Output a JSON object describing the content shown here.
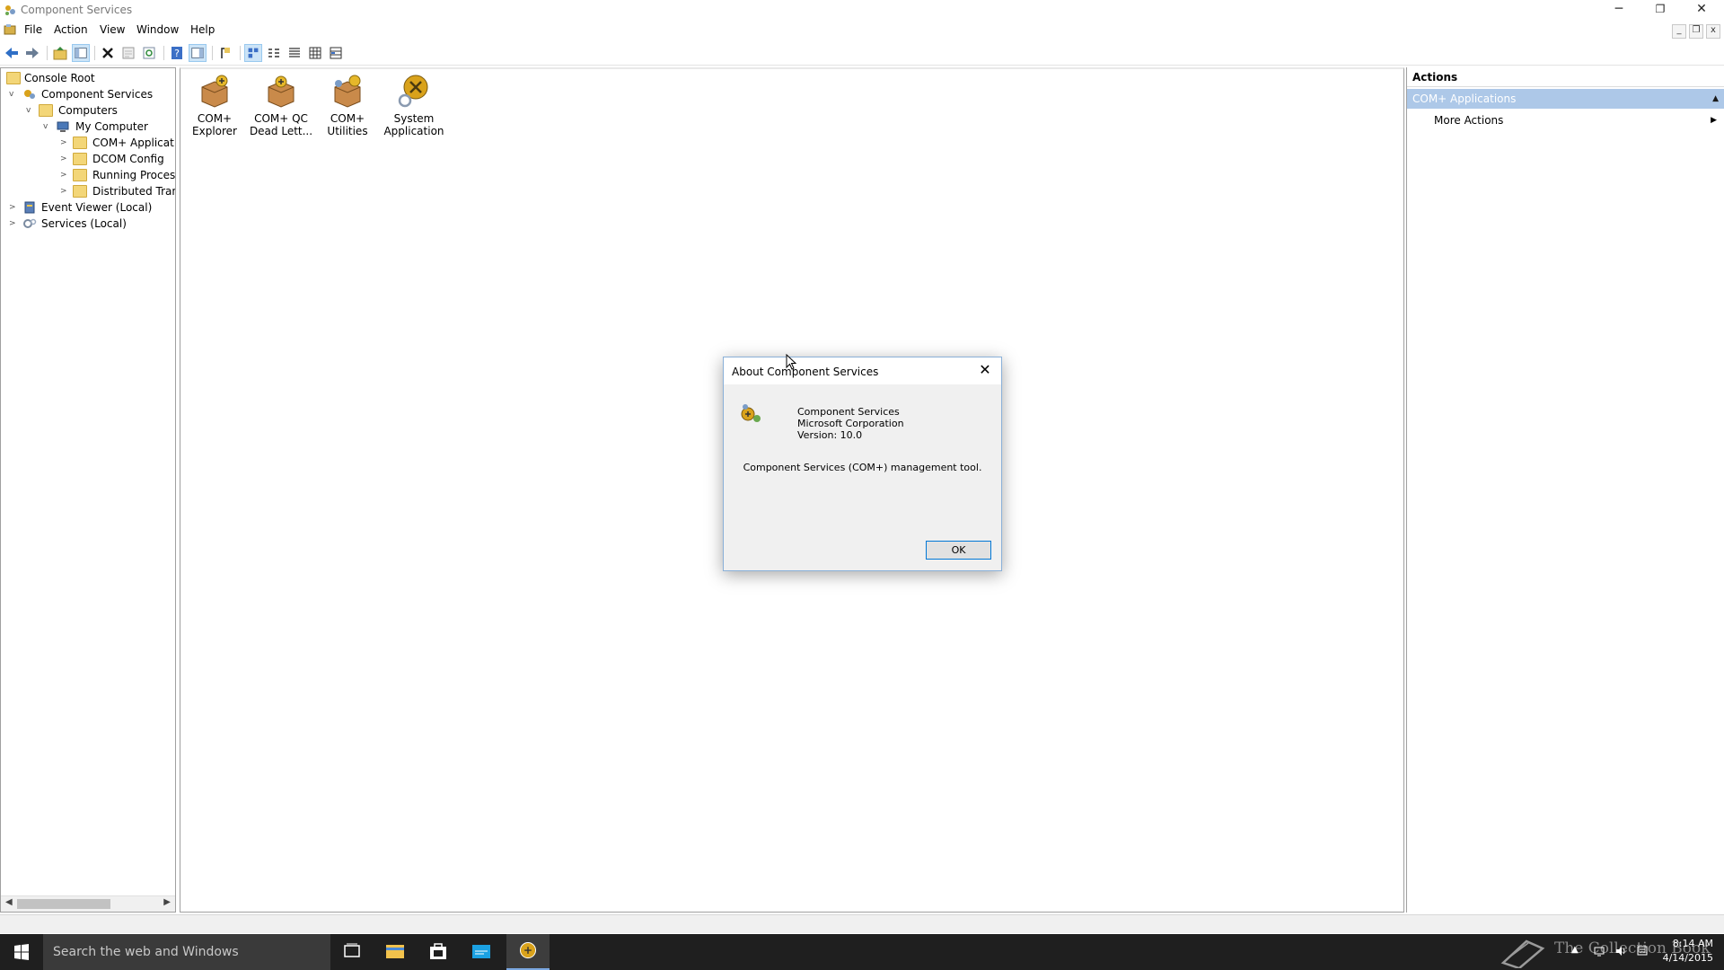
{
  "window": {
    "title": "Component Services",
    "controls": {
      "minimize": "─",
      "restore": "❐",
      "close": "✕"
    }
  },
  "menu": {
    "items": [
      {
        "label": "File"
      },
      {
        "label": "Action"
      },
      {
        "label": "View"
      },
      {
        "label": "Window"
      },
      {
        "label": "Help"
      }
    ],
    "mdi": {
      "minimize": "_",
      "restore": "❐",
      "close": "x"
    }
  },
  "toolbar": {
    "icons": [
      "back-icon",
      "forward-icon",
      "up-folder-icon",
      "show-hide-tree-icon",
      "delete-icon",
      "properties-icon",
      "refresh-icon",
      "help-icon",
      "show-hide-action-pane-icon",
      "export-list-icon",
      "large-icons-view-icon",
      "small-icons-view-icon",
      "list-view-icon",
      "detail-view-icon",
      "status-view-icon"
    ]
  },
  "tree": {
    "items": [
      {
        "label": "Console Root",
        "level": 0,
        "expander": "",
        "icon": "folder"
      },
      {
        "label": "Component Services",
        "level": 1,
        "expander": "v",
        "icon": "component-services"
      },
      {
        "label": "Computers",
        "level": 2,
        "expander": "v",
        "icon": "folder"
      },
      {
        "label": "My Computer",
        "level": 3,
        "expander": "v",
        "icon": "computer"
      },
      {
        "label": "COM+ Applications",
        "level": 4,
        "expander": ">",
        "icon": "folder"
      },
      {
        "label": "DCOM Config",
        "level": 4,
        "expander": ">",
        "icon": "folder"
      },
      {
        "label": "Running Processes",
        "level": 4,
        "expander": ">",
        "icon": "folder"
      },
      {
        "label": "Distributed Transaction Coordinator",
        "level": 4,
        "expander": ">",
        "icon": "folder"
      },
      {
        "label": "Event Viewer (Local)",
        "level": 1,
        "expander": ">",
        "icon": "event-viewer"
      },
      {
        "label": "Services (Local)",
        "level": 1,
        "expander": ">",
        "icon": "services"
      }
    ]
  },
  "content": {
    "items": [
      {
        "line1": "COM+",
        "line2": "Explorer"
      },
      {
        "line1": "COM+ QC",
        "line2": "Dead Lett..."
      },
      {
        "line1": "COM+",
        "line2": "Utilities"
      },
      {
        "line1": "System",
        "line2": "Application"
      }
    ]
  },
  "actions": {
    "title": "Actions",
    "section": "COM+ Applications",
    "more": "More Actions"
  },
  "dialog": {
    "title": "About Component Services",
    "product": "Component Services",
    "company": "Microsoft Corporation",
    "version": "Version: 10.0",
    "description": "Component Services (COM+) management tool.",
    "ok_label": "OK"
  },
  "taskbar": {
    "search_placeholder": "Search the web and Windows",
    "clock_time": "8:14 AM",
    "clock_date": "4/14/2015",
    "watermark": "The Collection Book"
  },
  "colors": {
    "accent": "#0078d7",
    "actions_section_bg": "#adc8e8",
    "taskbar_bg": "#1f1f1f"
  }
}
